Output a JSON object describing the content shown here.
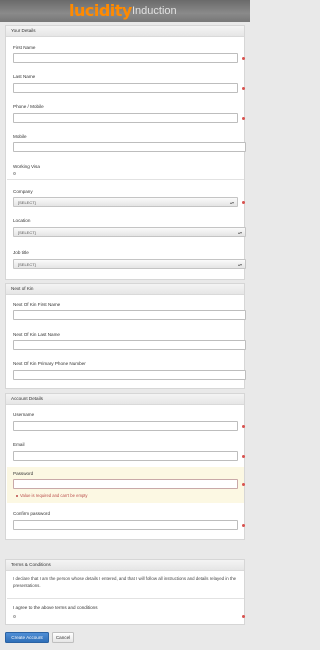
{
  "header": {
    "logo": "lucidity",
    "subtitle": "Induction"
  },
  "your_details": {
    "title": "Your Details",
    "first_name_label": "First Name",
    "last_name_label": "Last Name",
    "phone_label": "Phone / Mobile",
    "mobile_label": "Mobile",
    "working_visa_label": "Working Visa",
    "company_label": "Company",
    "company_value": "[SELECT]",
    "location_label": "Location",
    "location_value": "[SELECT]",
    "job_title_label": "Job title",
    "job_title_value": "[SELECT]"
  },
  "next_of_kin": {
    "title": "Next of Kin",
    "first_name_label": "Next Of Kin First Name",
    "last_name_label": "Next Of Kin Last Name",
    "phone_label": "Next Of Kin Primary Phone Number"
  },
  "account_details": {
    "title": "Account Details",
    "username_label": "Username",
    "email_label": "Email",
    "password_label": "Password",
    "password_error": "Value is required and can't be empty",
    "confirm_password_label": "Confirm password"
  },
  "terms": {
    "title": "Terms & Conditions",
    "declaration": "I declare that I am the person whose details I entered, and that I will follow all instructions and details relayed in the presentations.",
    "agree_label": "I agree to the above terms and conditions"
  },
  "actions": {
    "create_label": "Create Account",
    "cancel_label": "Cancel"
  },
  "colors": {
    "accent": "#ff8a00",
    "required": "#d9534f",
    "error": "#b94a48",
    "primary": "#2f6fb8"
  }
}
